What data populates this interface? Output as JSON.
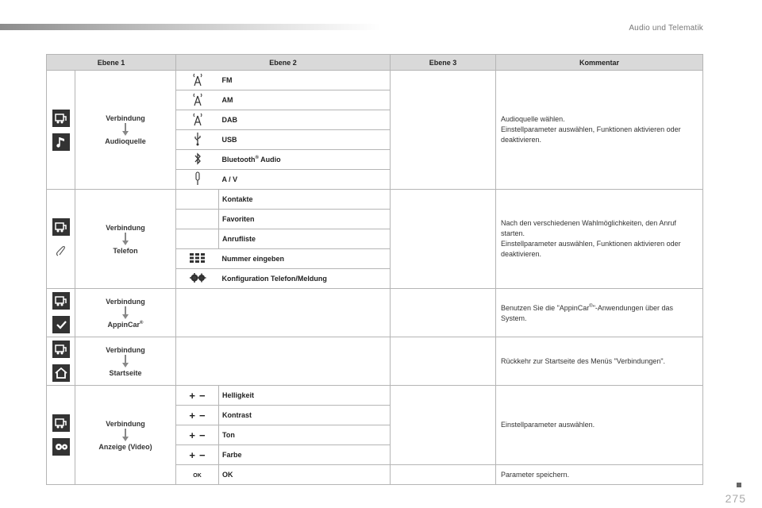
{
  "header": {
    "section_title": "Audio und Telematik",
    "page_number": "275"
  },
  "table": {
    "columns": [
      "Ebene 1",
      "Ebene 2",
      "Ebene 3",
      "Kommentar"
    ],
    "groups": [
      {
        "level1_top": "Verbindung",
        "level1_bottom": "Audioquelle",
        "items": [
          {
            "icon": "antenna-icon",
            "label": "FM"
          },
          {
            "icon": "antenna-icon",
            "label": "AM"
          },
          {
            "icon": "antenna-icon",
            "label": "DAB"
          },
          {
            "icon": "usb-icon",
            "label": "USB"
          },
          {
            "icon": "bluetooth-icon",
            "label": "Bluetooth",
            "label_sup": "®",
            "label_suffix": " Audio"
          },
          {
            "icon": "aux-jack-icon",
            "label": "A / V"
          }
        ],
        "comment": [
          "Audioquelle wählen.",
          "Einstellparameter auswählen, Funktionen aktivieren oder deaktivieren."
        ]
      },
      {
        "level1_top": "Verbindung",
        "level1_bottom": "Telefon",
        "items": [
          {
            "icon": "",
            "label": "Kontakte"
          },
          {
            "icon": "",
            "label": "Favoriten"
          },
          {
            "icon": "",
            "label": "Anrufliste"
          },
          {
            "icon": "keypad-icon",
            "label": "Nummer eingeben"
          },
          {
            "icon": "gears-icon",
            "label": "Konfiguration Telefon/Meldung"
          }
        ],
        "comment": [
          "Nach den verschiedenen Wahlmöglichkeiten, den Anruf starten.",
          "Einstellparameter auswählen, Funktionen aktivieren oder deaktivieren."
        ]
      },
      {
        "level1_top": "Verbindung",
        "level1_bottom": "AppinCar",
        "level1_bottom_sup": "®",
        "comment_a": "Benutzen Sie die \"AppinCar",
        "comment_sup": "®",
        "comment_b": "\"-Anwendungen über das System."
      },
      {
        "level1_top": "Verbindung",
        "level1_bottom": "Startseite",
        "comment": "Rückkehr zur Startseite des Menüs \"Verbindungen\"."
      },
      {
        "level1_top": "Verbindung",
        "level1_bottom": "Anzeige (Video)",
        "items": [
          {
            "plus": "+",
            "minus": "−",
            "label": "Helligkeit"
          },
          {
            "plus": "+",
            "minus": "−",
            "label": "Kontrast"
          },
          {
            "plus": "+",
            "minus": "−",
            "label": "Ton"
          },
          {
            "plus": "+",
            "minus": "−",
            "label": "Farbe"
          }
        ],
        "ok_glyph": "OK",
        "ok_label": "OK",
        "comment": "Einstellparameter auswählen.",
        "ok_comment": "Parameter speichern."
      }
    ]
  },
  "colors": {
    "icon_bg": "#333333",
    "header_bg": "#d9d9d9",
    "border": "#b5b5b5"
  }
}
